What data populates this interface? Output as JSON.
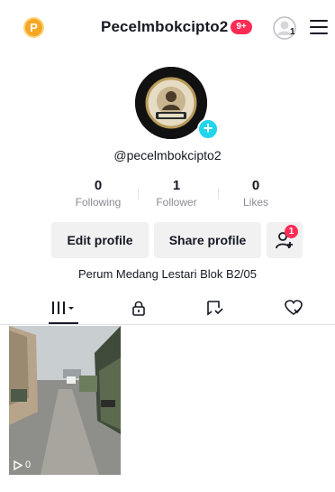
{
  "header": {
    "coin_label": "P",
    "username": "Pecelmbokcipto2",
    "notif_badge": "9+",
    "account_count": "1"
  },
  "profile": {
    "handle": "@pecelmbokcipto2",
    "avatar_text": "PECEL MBOK CIPTO 2",
    "stats": [
      {
        "value": "0",
        "label": "Following"
      },
      {
        "value": "1",
        "label": "Follower"
      },
      {
        "value": "0",
        "label": "Likes"
      }
    ],
    "bio": "Perum Medang Lestari Blok B2/05"
  },
  "buttons": {
    "edit_profile": "Edit profile",
    "share_profile": "Share profile",
    "add_friend_badge": "1"
  },
  "tabs": [
    "videos-grid",
    "private",
    "reposts",
    "liked"
  ],
  "videos": [
    {
      "views": "0"
    }
  ],
  "colors": {
    "accent": "#fe2c55",
    "cyan": "#20d5ec",
    "coin": "#f5a623"
  }
}
